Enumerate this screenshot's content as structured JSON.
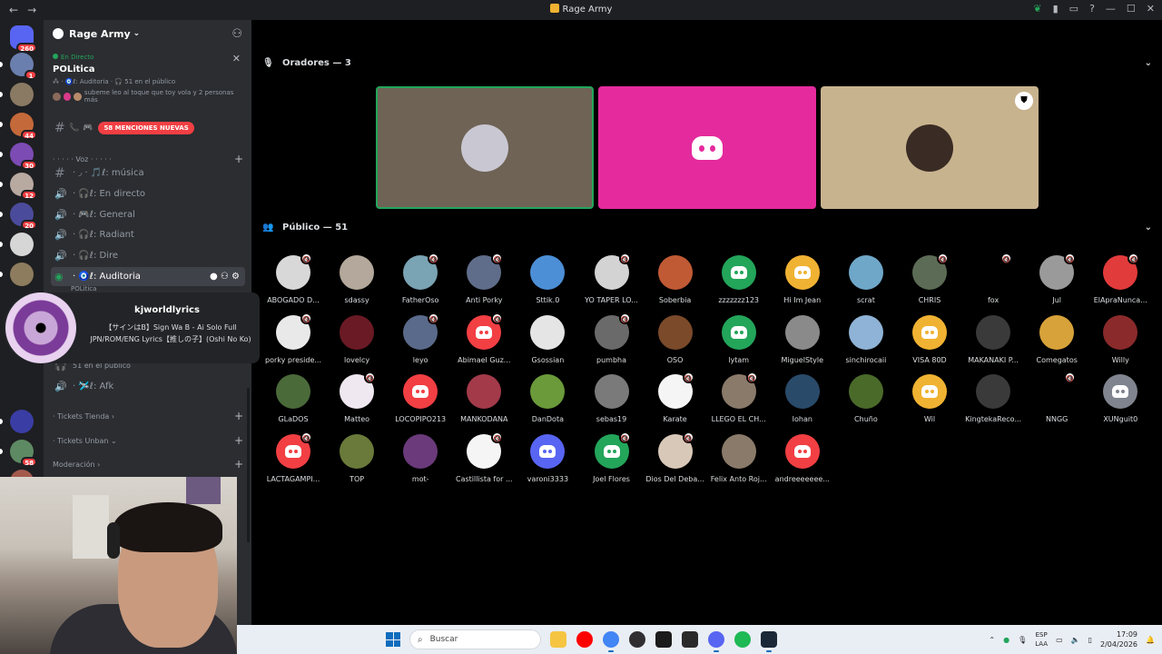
{
  "window": {
    "title": "Rage Army",
    "back": "←",
    "forward": "→",
    "controls": [
      "—",
      "☐",
      "✕"
    ]
  },
  "servers": {
    "home_badge": "260",
    "items": [
      {
        "badge": "1",
        "color": "#6b7fae"
      },
      {
        "badge": "",
        "color": "#8a7a63"
      },
      {
        "badge": "44",
        "color": "#c4693a"
      },
      {
        "badge": "30",
        "color": "#7c4bb3"
      },
      {
        "badge": "12",
        "color": "#b8a9a1"
      },
      {
        "badge": "20",
        "color": "#4b4b9b"
      },
      {
        "badge": "",
        "color": "#d6d6d6"
      },
      {
        "badge": "",
        "color": "#8e7c5e"
      }
    ],
    "lower_items": [
      {
        "badge": "",
        "color": "#3a3da3"
      },
      {
        "badge": "58",
        "color": "#5e8a63"
      },
      {
        "badge": "",
        "color": "#a35a4d"
      },
      {
        "badge": "",
        "color": "#7d3fa0"
      }
    ]
  },
  "guild": {
    "name": "Rage Army",
    "event": {
      "live_label": "En Directo",
      "title": "POLitica",
      "meta": "⁂ · 🧿ℓ: Auditoria · 🎧 51 en el público",
      "people": "subeme leo al toque que toy vola y 2 personas más"
    },
    "mentions_badge": "58 MENCIONES NUEVAS",
    "voice_category": "· · · · · Voz · · · · ·",
    "channels": [
      {
        "name": "· ◞ · 🎵ℓ: música",
        "type": "text"
      },
      {
        "name": "· 🎧ℓ: En directo",
        "type": "voice"
      },
      {
        "name": "· 🎮ℓ: General",
        "type": "voice"
      },
      {
        "name": "· 🎧ℓ: Radiant",
        "type": "voice"
      },
      {
        "name": "· 🎧ℓ: Dire",
        "type": "voice"
      },
      {
        "name": "· 🧿ℓ: Auditoria",
        "type": "stage"
      }
    ],
    "active_sub": "POLitica",
    "audience_line": "51 en el público",
    "afk": "· 🛩️ℓ: Afk",
    "categories": [
      "· Tickets Tienda ›",
      "· Tickets Unban ⌄",
      "Moderación ›"
    ]
  },
  "spotify": {
    "channel": "kjworldlyrics",
    "song": "【サインはB】Sign Wa B - Ai Solo Full JPN/ROM/ENG Lyrics【推しの子】(Oshi No Ko)"
  },
  "stage": {
    "speakers_label": "Oradores — 3",
    "audience_label": "Público — 51",
    "speakers": [
      {
        "bg": "#6e6355",
        "speaking": true,
        "avatar": "#c9c7d2"
      },
      {
        "bg": "#e42a9d",
        "speaking": false,
        "avatar": "discord"
      },
      {
        "bg": "#c8b38f",
        "speaking": false,
        "avatar": "#3a2c24",
        "mod": true
      }
    ],
    "audience": [
      {
        "name": "ABOGADO D...",
        "color": "#d8d8d8",
        "muted": true
      },
      {
        "name": "sdassy",
        "color": "#b3a89b",
        "muted": false
      },
      {
        "name": "FatherOso",
        "color": "#7aa3b3",
        "muted": true
      },
      {
        "name": "Anti Porky",
        "color": "#5f6d8a",
        "muted": true
      },
      {
        "name": "Sttik.0",
        "color": "#4d8fd6",
        "muted": false
      },
      {
        "name": "YO TAPER LO...",
        "color": "#d3d3d3",
        "muted": true
      },
      {
        "name": "Soberbia",
        "color": "#c05a35",
        "muted": false
      },
      {
        "name": "zzzzzzz123",
        "color": "#23a55a",
        "muted": false,
        "discord": true
      },
      {
        "name": "Hi Im Jean",
        "color": "#f0b232",
        "muted": false,
        "discord": true
      },
      {
        "name": "scrat",
        "color": "#6fa7c9",
        "muted": false
      },
      {
        "name": "CHRIS",
        "color": "#5c6b55",
        "muted": true
      },
      {
        "name": "fox",
        "color": "#000000",
        "muted": true
      },
      {
        "name": "Jul",
        "color": "#9a9a9a",
        "muted": true
      },
      {
        "name": "ElApraNunca...",
        "color": "#e23b3b",
        "muted": true
      },
      {
        "name": "porky preside...",
        "color": "#e9e9e9",
        "muted": true
      },
      {
        "name": "lovelcy",
        "color": "#6a1a24",
        "muted": false
      },
      {
        "name": "leyo",
        "color": "#5a6a8a",
        "muted": true
      },
      {
        "name": "Abimael Guz...",
        "color": "#f23f43",
        "muted": true,
        "discord": true
      },
      {
        "name": "Gsossian",
        "color": "#e5e5e5",
        "muted": false
      },
      {
        "name": "pumbha",
        "color": "#6a6a6a",
        "muted": true
      },
      {
        "name": "OSO",
        "color": "#7a4a2a",
        "muted": false
      },
      {
        "name": "lytam",
        "color": "#23a55a",
        "muted": false,
        "discord": true
      },
      {
        "name": "MiguelStyle",
        "color": "#8a8a8a",
        "muted": false
      },
      {
        "name": "sinchirocaii",
        "color": "#8fb3d6",
        "muted": false
      },
      {
        "name": "VISA 80D",
        "color": "#f0b232",
        "muted": false,
        "discord": true
      },
      {
        "name": "MAKANAKI P...",
        "color": "#3a3a3a",
        "muted": false
      },
      {
        "name": "Comegatos",
        "color": "#d8a23a",
        "muted": false
      },
      {
        "name": "Willy",
        "color": "#8a2a2a",
        "muted": false
      },
      {
        "name": "GLaDOS",
        "color": "#4a6a3a",
        "muted": false
      },
      {
        "name": "Matteo",
        "color": "#f0e8f0",
        "muted": true
      },
      {
        "name": "LOCOPIPO213",
        "color": "#f23f43",
        "muted": false,
        "discord": true
      },
      {
        "name": "MANKODANA",
        "color": "#a33a4a",
        "muted": false
      },
      {
        "name": "DanDota",
        "color": "#6a9a3a",
        "muted": false
      },
      {
        "name": "sebas19",
        "color": "#7a7a7a",
        "muted": false
      },
      {
        "name": "Karate",
        "color": "#f5f5f5",
        "muted": true
      },
      {
        "name": "LLEGO EL CH...",
        "color": "#8a7a6a",
        "muted": true
      },
      {
        "name": "Iohan",
        "color": "#2a4a6a",
        "muted": false
      },
      {
        "name": "Chuño",
        "color": "#4a6a2a",
        "muted": false
      },
      {
        "name": "Wil",
        "color": "#f0b232",
        "muted": false,
        "discord": true
      },
      {
        "name": "KingtekaReco...",
        "color": "#3a3a3a",
        "muted": false
      },
      {
        "name": "NNGG",
        "color": "#000000",
        "muted": true
      },
      {
        "name": "XUNguit0",
        "color": "#80848e",
        "muted": false,
        "discord": true
      },
      {
        "name": "LACTAGAMPI...",
        "color": "#f23f43",
        "muted": true,
        "discord": true
      },
      {
        "name": "TOP",
        "color": "#6a7a3a",
        "muted": false
      },
      {
        "name": "mot-",
        "color": "#6a3a7a",
        "muted": false
      },
      {
        "name": "Castillista for ...",
        "color": "#f5f5f5",
        "muted": true
      },
      {
        "name": "varoni3333",
        "color": "#5865f2",
        "muted": false,
        "discord": true
      },
      {
        "name": "Joel Flores",
        "color": "#23a55a",
        "muted": true,
        "discord": true
      },
      {
        "name": "Dios Del Deba...",
        "color": "#d8c8b8",
        "muted": true
      },
      {
        "name": "Felix Anto Roj...",
        "color": "#8a7a6a",
        "muted": false
      },
      {
        "name": "andreeeeeee...",
        "color": "#f23f43",
        "muted": false,
        "discord": true
      }
    ]
  },
  "taskbar": {
    "search_placeholder": "Buscar",
    "apps": [
      {
        "name": "files",
        "color": "#f5c542"
      },
      {
        "name": "youtube",
        "color": "#ff0000"
      },
      {
        "name": "chrome",
        "color": "#4285f4"
      },
      {
        "name": "obs",
        "color": "#302e31"
      },
      {
        "name": "clip",
        "color": "#1b1b1b"
      },
      {
        "name": "opera-gx",
        "color": "#2a2a2a"
      },
      {
        "name": "discord",
        "color": "#5865f2"
      },
      {
        "name": "spotify",
        "color": "#1db954"
      },
      {
        "name": "steam",
        "color": "#1b2838"
      }
    ],
    "lang_top": "ESP",
    "lang_bottom": "LAA",
    "time": "17:09",
    "date": "2/04/2026"
  }
}
